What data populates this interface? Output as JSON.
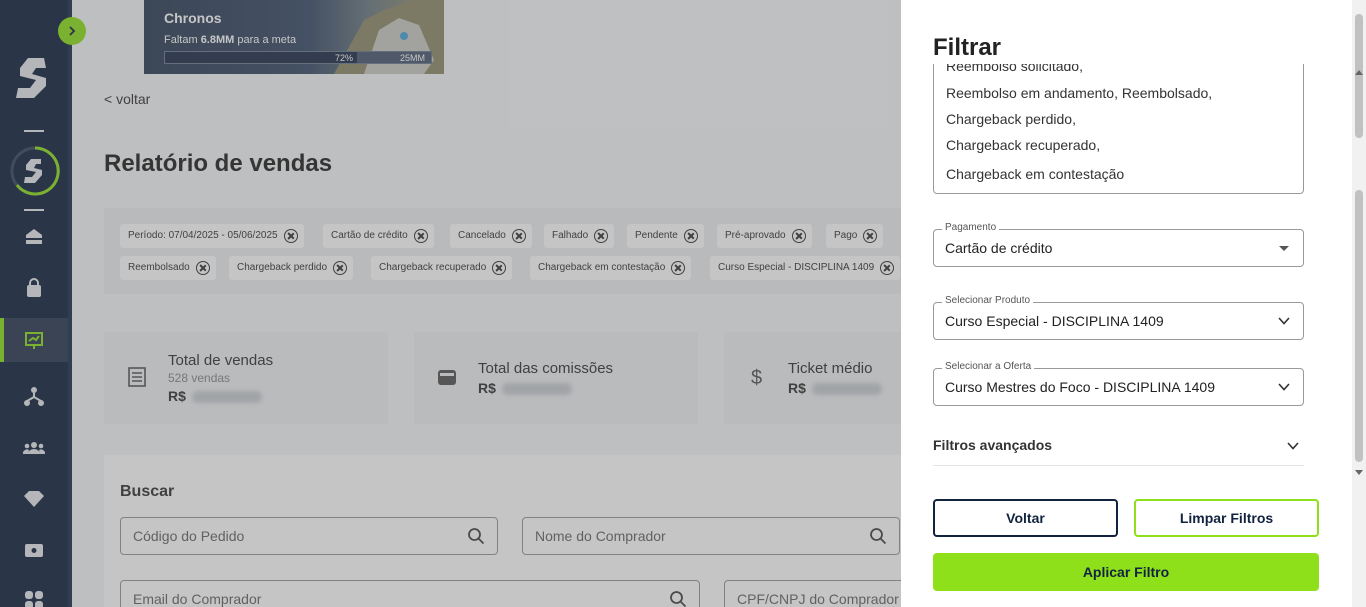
{
  "banner": {
    "title": "Chronos",
    "sub_prefix": "Faltam ",
    "sub_amount": "6.8MM",
    "sub_suffix": " para a meta",
    "progress_pct_label": "72%",
    "progress": 0.72,
    "goal_label": "25MM"
  },
  "main": {
    "back_label": "< voltar",
    "page_title": "Relatório de vendas",
    "chips_row1": [
      "Período: 07/04/2025 - 05/06/2025",
      "Cartão de crédito",
      "Cancelado",
      "Falhado",
      "Pendente",
      "Pré-aprovado",
      "Pago"
    ],
    "chips_row2": [
      "Reembolsado",
      "Chargeback perdido",
      "Chargeback recuperado",
      "Chargeback em contestação",
      "Curso Especial - DISCIPLINA 1409"
    ],
    "stats": [
      {
        "label": "Total de vendas",
        "sub": "528 vendas",
        "currency": "R$"
      },
      {
        "label": "Total das comissões",
        "sub": "",
        "currency": "R$"
      },
      {
        "label": "Ticket médio",
        "sub": "",
        "currency": "R$"
      }
    ],
    "search": {
      "title": "Buscar",
      "order_code_placeholder": "Código do Pedido",
      "buyer_name_placeholder": "Nome do Comprador",
      "buyer_email_placeholder": "Email do Comprador",
      "buyer_doc_placeholder": "CPF/CNPJ do Comprador"
    }
  },
  "panel": {
    "title": "Filtrar",
    "status_lines": [
      "Reembolso solicitado,",
      "Reembolso em andamento, Reembolsado,",
      "Chargeback perdido,",
      "Chargeback recuperado,",
      "Chargeback em contestação"
    ],
    "payment": {
      "label": "Pagamento",
      "value": "Cartão de crédito"
    },
    "product": {
      "label": "Selecionar Produto",
      "value": "Curso Especial - DISCIPLINA 1409"
    },
    "offer": {
      "label": "Selecionar a Oferta",
      "value": "Curso Mestres do Foco - DISCIPLINA 1409"
    },
    "advanced_label": "Filtros avançados",
    "back_button": "Voltar",
    "clear_button": "Limpar Filtros",
    "apply_button": "Aplicar Filtro"
  },
  "colors": {
    "accent": "#8ee01b",
    "navy": "#12233f"
  },
  "icons": [
    "chevron-right-icon",
    "logo-icon",
    "home-icon",
    "bag-icon",
    "sales-report-icon",
    "affiliates-icon",
    "users-icon",
    "diamond-icon",
    "ticket-icon",
    "apps-icon",
    "document-icon",
    "wallet-icon",
    "dollar-icon",
    "search-icon",
    "caret-down-icon",
    "chevron-down-icon"
  ]
}
